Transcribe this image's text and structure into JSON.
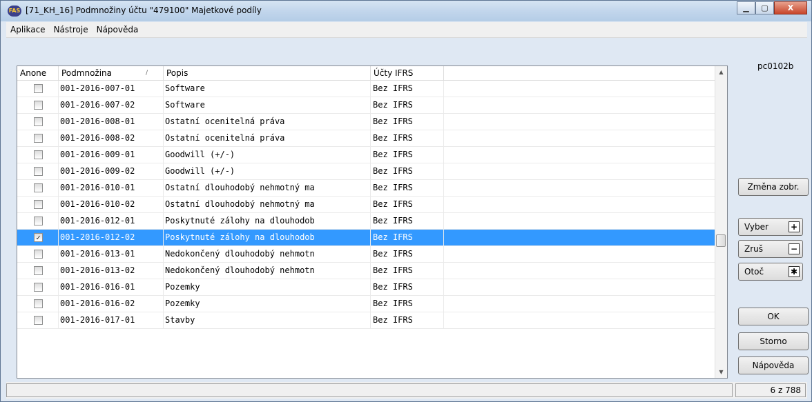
{
  "window": {
    "title": "[71_KH_16] Podmnožiny účtu \"479100\" Majetkové podíly",
    "app_icon_text": "FAS",
    "minimize": "▁",
    "maximize": "▢",
    "close": "X"
  },
  "menu": [
    "Aplikace",
    "Nástroje",
    "Nápověda"
  ],
  "grid": {
    "columns": [
      "Anone",
      "Podmnožina",
      "Popis",
      "Účty IFRS"
    ],
    "sort_indicator": "∕",
    "rows": [
      {
        "checked": false,
        "podmnozina": "001-2016-007-01",
        "popis": "Software",
        "ucty": "Bez IFRS"
      },
      {
        "checked": false,
        "podmnozina": "001-2016-007-02",
        "popis": "Software",
        "ucty": "Bez IFRS"
      },
      {
        "checked": false,
        "podmnozina": "001-2016-008-01",
        "popis": "Ostatní ocenitelná práva",
        "ucty": "Bez IFRS"
      },
      {
        "checked": false,
        "podmnozina": "001-2016-008-02",
        "popis": "Ostatní ocenitelná práva",
        "ucty": "Bez IFRS"
      },
      {
        "checked": false,
        "podmnozina": "001-2016-009-01",
        "popis": "Goodwill (+/-)",
        "ucty": "Bez IFRS"
      },
      {
        "checked": false,
        "podmnozina": "001-2016-009-02",
        "popis": "Goodwill (+/-)",
        "ucty": "Bez IFRS"
      },
      {
        "checked": false,
        "podmnozina": "001-2016-010-01",
        "popis": "Ostatní dlouhodobý nehmotný ma",
        "ucty": "Bez IFRS"
      },
      {
        "checked": false,
        "podmnozina": "001-2016-010-02",
        "popis": "Ostatní dlouhodobý nehmotný ma",
        "ucty": "Bez IFRS"
      },
      {
        "checked": false,
        "podmnozina": "001-2016-012-01",
        "popis": "Poskytnuté zálohy na dlouhodob",
        "ucty": "Bez IFRS"
      },
      {
        "checked": true,
        "selected": true,
        "podmnozina": "001-2016-012-02",
        "popis": "Poskytnuté zálohy na dlouhodob",
        "ucty": "Bez IFRS"
      },
      {
        "checked": false,
        "podmnozina": "001-2016-013-01",
        "popis": "Nedokončený dlouhodobý nehmotn",
        "ucty": "Bez IFRS"
      },
      {
        "checked": false,
        "podmnozina": "001-2016-013-02",
        "popis": "Nedokončený dlouhodobý nehmotn",
        "ucty": "Bez IFRS"
      },
      {
        "checked": false,
        "podmnozina": "001-2016-016-01",
        "popis": "Pozemky",
        "ucty": "Bez IFRS"
      },
      {
        "checked": false,
        "podmnozina": "001-2016-016-02",
        "popis": "Pozemky",
        "ucty": "Bez IFRS"
      },
      {
        "checked": false,
        "podmnozina": "001-2016-017-01",
        "popis": "Stavby",
        "ucty": "Bez IFRS"
      }
    ]
  },
  "side": {
    "form_id": "pc0102b",
    "zmena": "Změna zobr.",
    "vyber": "Vyber",
    "vyber_sym": "+",
    "zrus": "Zruš",
    "zrus_sym": "−",
    "otoc": "Otoč",
    "otoc_sym": "✱",
    "ok": "OK",
    "storno": "Storno",
    "napoveda": "Nápověda"
  },
  "status": {
    "left": "",
    "count": "6 z 788"
  },
  "colors": {
    "selection": "#3399ff",
    "titlebar": "#c2d6ec"
  }
}
